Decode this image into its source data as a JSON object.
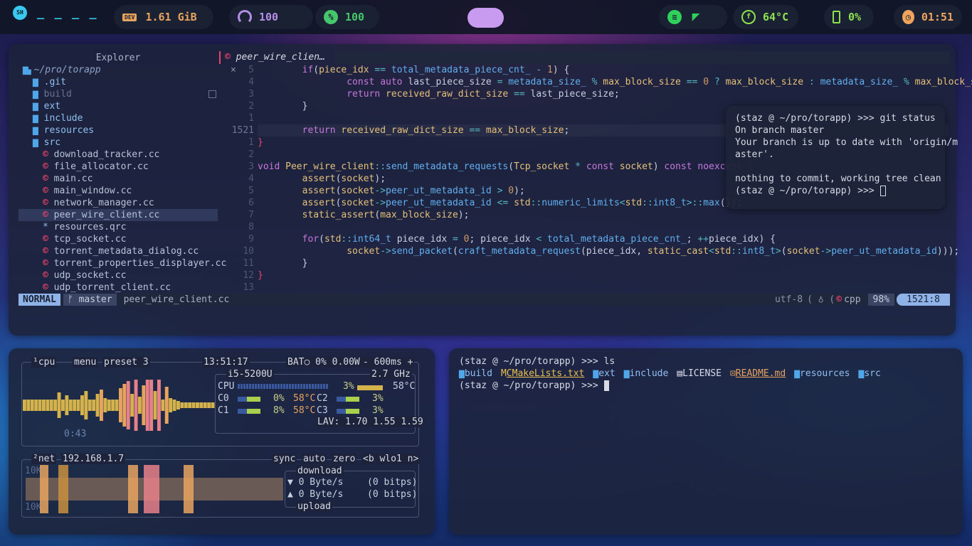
{
  "topbar": {
    "workspaces": "_ _ _ _",
    "dev_label": "DEV",
    "memory": "1.61 GiB",
    "volume": "100",
    "updates": "100",
    "temp": "64°C",
    "battery": "0%",
    "clock": "01:51",
    "colors": {
      "memory": "#e8a35f",
      "volume": "#b48fe8",
      "updates": "#47c76b",
      "temp": "#8ee24f",
      "battery": "#8ee24f",
      "clock": "#f0a45c",
      "center_pill": "#c89af0"
    }
  },
  "editor": {
    "explorer_title": "Explorer",
    "root": "~/pro/torapp",
    "tree": [
      {
        "name": ".git",
        "kind": "dir",
        "indent": 1
      },
      {
        "name": "build",
        "kind": "dir",
        "indent": 1,
        "dim": true
      },
      {
        "name": "ext",
        "kind": "dir",
        "indent": 1
      },
      {
        "name": "include",
        "kind": "dir",
        "indent": 1
      },
      {
        "name": "resources",
        "kind": "dir",
        "indent": 1
      },
      {
        "name": "src",
        "kind": "dir-open",
        "indent": 1
      },
      {
        "name": "download_tracker.cc",
        "kind": "cpp",
        "indent": 2
      },
      {
        "name": "file_allocator.cc",
        "kind": "cpp",
        "indent": 2
      },
      {
        "name": "main.cc",
        "kind": "cpp",
        "indent": 2
      },
      {
        "name": "main_window.cc",
        "kind": "cpp",
        "indent": 2
      },
      {
        "name": "network_manager.cc",
        "kind": "cpp",
        "indent": 2
      },
      {
        "name": "peer_wire_client.cc",
        "kind": "cpp",
        "indent": 2,
        "selected": true
      },
      {
        "name": "resources.qrc",
        "kind": "qrc",
        "indent": 2
      },
      {
        "name": "tcp_socket.cc",
        "kind": "cpp",
        "indent": 2
      },
      {
        "name": "torrent_metadata_dialog.cc",
        "kind": "cpp",
        "indent": 2
      },
      {
        "name": "torrent_properties_displayer.cc",
        "kind": "cpp",
        "indent": 2
      },
      {
        "name": "udp_socket.cc",
        "kind": "cpp",
        "indent": 2
      },
      {
        "name": "udp_torrent_client.cc",
        "kind": "cpp",
        "indent": 2
      }
    ],
    "tab_title": "peer_wire_clien…",
    "tab_close": "×",
    "line_numbers": [
      "5",
      "4",
      "3",
      "2",
      "1",
      "1521",
      "1",
      "2",
      "3",
      "4",
      "5",
      "6",
      "7",
      "8",
      "9",
      "10",
      "11",
      "12",
      "13"
    ],
    "status": {
      "mode": "NORMAL",
      "branch": "master",
      "file": "peer_wire_client.cc",
      "encoding": "utf-8",
      "lang": "cpp",
      "percent": "98%",
      "position": "1521:8"
    }
  },
  "popup_terminal": {
    "lines": [
      "(staz @ ~/pro/torapp) >>> git status",
      "On branch master",
      "Your branch is up to date with 'origin/m",
      "aster'.",
      "",
      "nothing to commit, working tree clean",
      "(staz @ ~/pro/torapp) >>> "
    ]
  },
  "btop": {
    "cpu_label": "¹cpu",
    "menu": "menu",
    "preset": "preset 3",
    "time": "13:51:17",
    "bat": "BAT○ 0% 0.00W",
    "rate": "- 600ms +",
    "cpu_model": "i5-5200U",
    "freq": "2.7 GHz",
    "cpu_total_label": "CPU",
    "cpu_total": "3%",
    "cpu_temp": "58°C",
    "uptime": "0:43",
    "cores": [
      {
        "name": "C0",
        "pct": "0%",
        "temp": "58°C"
      },
      {
        "name": "C1",
        "pct": "8%",
        "temp": "58°C"
      },
      {
        "name": "C2",
        "pct": "3%"
      },
      {
        "name": "C3",
        "pct": "3%"
      }
    ],
    "lav": "LAV: 1.70 1.55 1.59",
    "net_label": "²net",
    "ip": "192.168.1.7",
    "sync": "sync",
    "auto": "auto",
    "zero": "zero",
    "iface": "<b wlo1 n>",
    "scale_top": "10K",
    "scale_bottom": "10K",
    "download": "download",
    "upload": "upload",
    "dl_rate": "▼ 0 Byte/s",
    "dl_bits": "(0 bitps)",
    "ul_rate": "▲ 0 Byte/s",
    "ul_bits": "(0 bitps)"
  },
  "terminal": {
    "prompt1": "(staz @ ~/pro/torapp) >>> ls",
    "ls": [
      {
        "name": "build",
        "kind": "dir"
      },
      {
        "name": "CMakeLists.txt",
        "kind": "file-cmake"
      },
      {
        "name": "ext",
        "kind": "dir"
      },
      {
        "name": "include",
        "kind": "dir"
      },
      {
        "name": "LICENSE",
        "kind": "file"
      },
      {
        "name": "README.md",
        "kind": "file-md"
      },
      {
        "name": "resources",
        "kind": "dir"
      },
      {
        "name": "src",
        "kind": "dir"
      }
    ],
    "prompt2": "(staz @ ~/pro/torapp) >>> "
  }
}
